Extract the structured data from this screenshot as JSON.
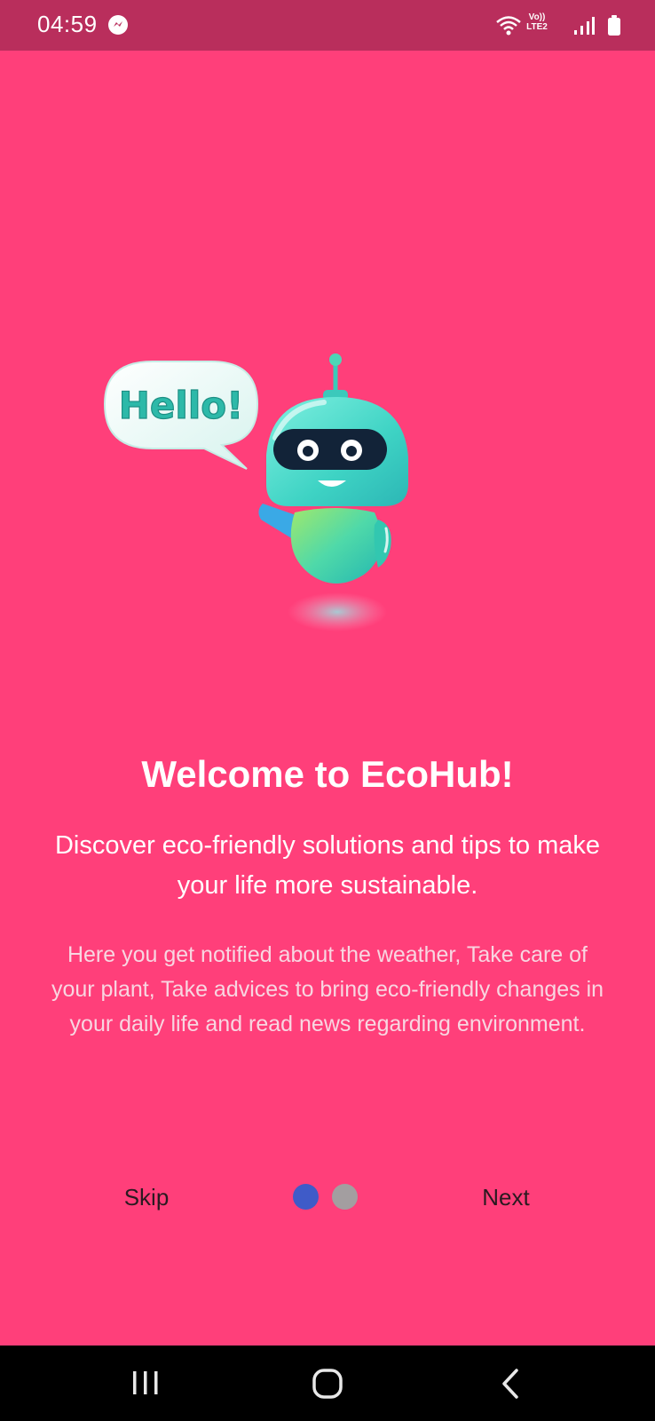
{
  "status_bar": {
    "time": "04:59",
    "network_label_top": "Vo))",
    "network_label_bottom": "LTE2",
    "icons": [
      "messenger-icon",
      "wifi-icon",
      "lte-icon",
      "signal-icon",
      "battery-icon"
    ]
  },
  "illustration": {
    "speech_bubble_text": "Hello!"
  },
  "onboarding": {
    "title": "Welcome to EcoHub!",
    "subtitle": "Discover eco-friendly solutions and tips to make your life more sustainable.",
    "description": "Here you get notified about the weather, Take care of your plant, Take advices to bring eco-friendly changes in your daily life and read news regarding environment.",
    "skip_label": "Skip",
    "next_label": "Next",
    "page_indicator": {
      "current": 1,
      "total": 2
    }
  },
  "navigation_bar": {
    "icons": [
      "recents-icon",
      "home-icon",
      "back-icon"
    ]
  },
  "colors": {
    "background": "#ff3f7a",
    "status_bar": "#b92e5c",
    "dot_active": "#3f5bc8",
    "dot_inactive": "#a39ea0",
    "robot_teal": "#3ed3c4"
  }
}
